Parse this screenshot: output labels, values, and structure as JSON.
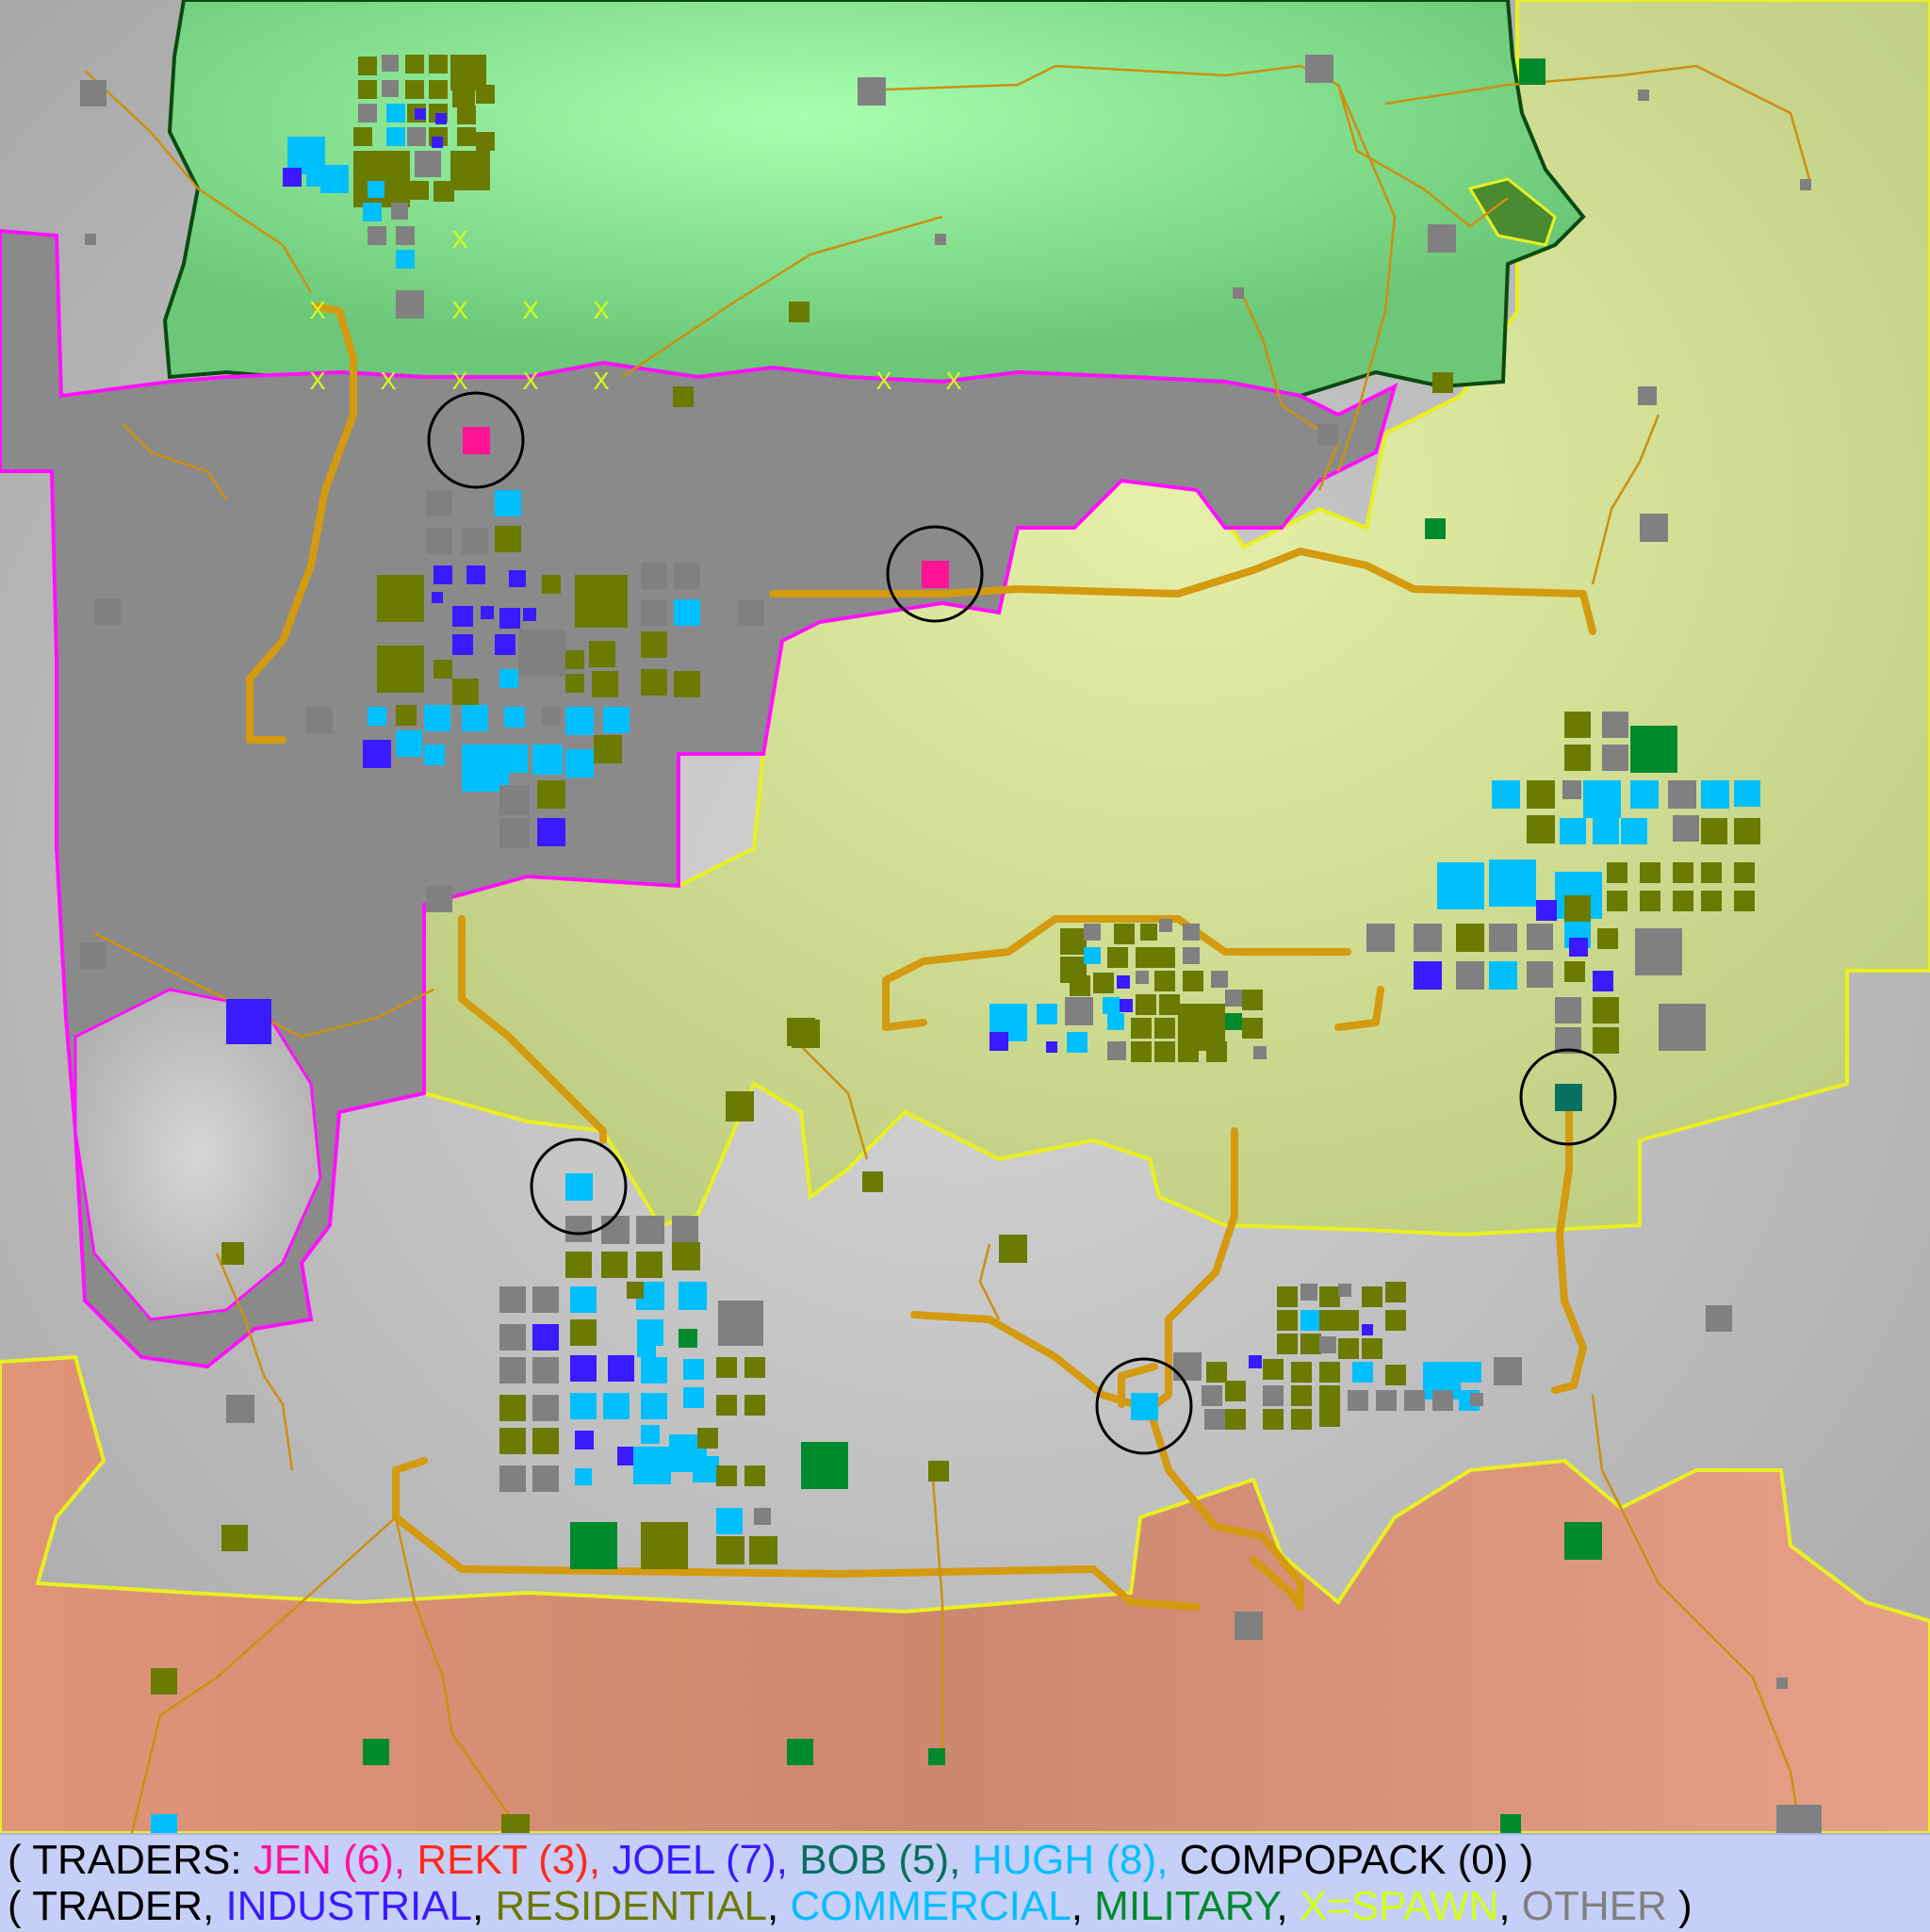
{
  "legend": {
    "line1": {
      "open": "( TRADERS: ",
      "jen": "JEN (6)",
      "sep1": ", ",
      "rekt": "REKT (3)",
      "sep2": ", ",
      "joel": "JOEL (7)",
      "sep3": ", ",
      "bob": "BOB (5)",
      "sep4": ", ",
      "hugh": "HUGH (8)",
      "sep5": ", ",
      "compopack": "COMPOPACK (0)",
      "close": "  )"
    },
    "line2": {
      "open": "( ",
      "trader": "TRADER",
      "sep1": ", ",
      "industrial": "INDUSTRIAL",
      "sep2": ", ",
      "residential": "RESIDENTIAL",
      "sep3": ", ",
      "commercial": "COMMERCIAL",
      "sep4": ", ",
      "military": "MILITARY",
      "sep5": ", ",
      "spawn": "X=SPAWN",
      "sep6": ", ",
      "other": "OTHER",
      "close": " )"
    }
  },
  "colors": {
    "jen": "#ff1493",
    "rekt": "#ff2a1a",
    "joel": "#3a1aff",
    "bob": "#087060",
    "hugh": "#00bfff",
    "compopack": "#000000",
    "trader": "#000000",
    "industrial": "#3a1aff",
    "residential": "#6b7a00",
    "commercial": "#00bfff",
    "military": "#008a2e",
    "spawn": "#d4ff1a",
    "other": "#808080",
    "forest_biome": "#70c878",
    "burnt_biome": "#8a8a8a",
    "desert_biome": "#c6d48a",
    "snow_biome": "#c0c0c0",
    "wasteland_biome": "#d98a70",
    "road": "#d49a10"
  },
  "map": {
    "spawn_marker": "X"
  }
}
